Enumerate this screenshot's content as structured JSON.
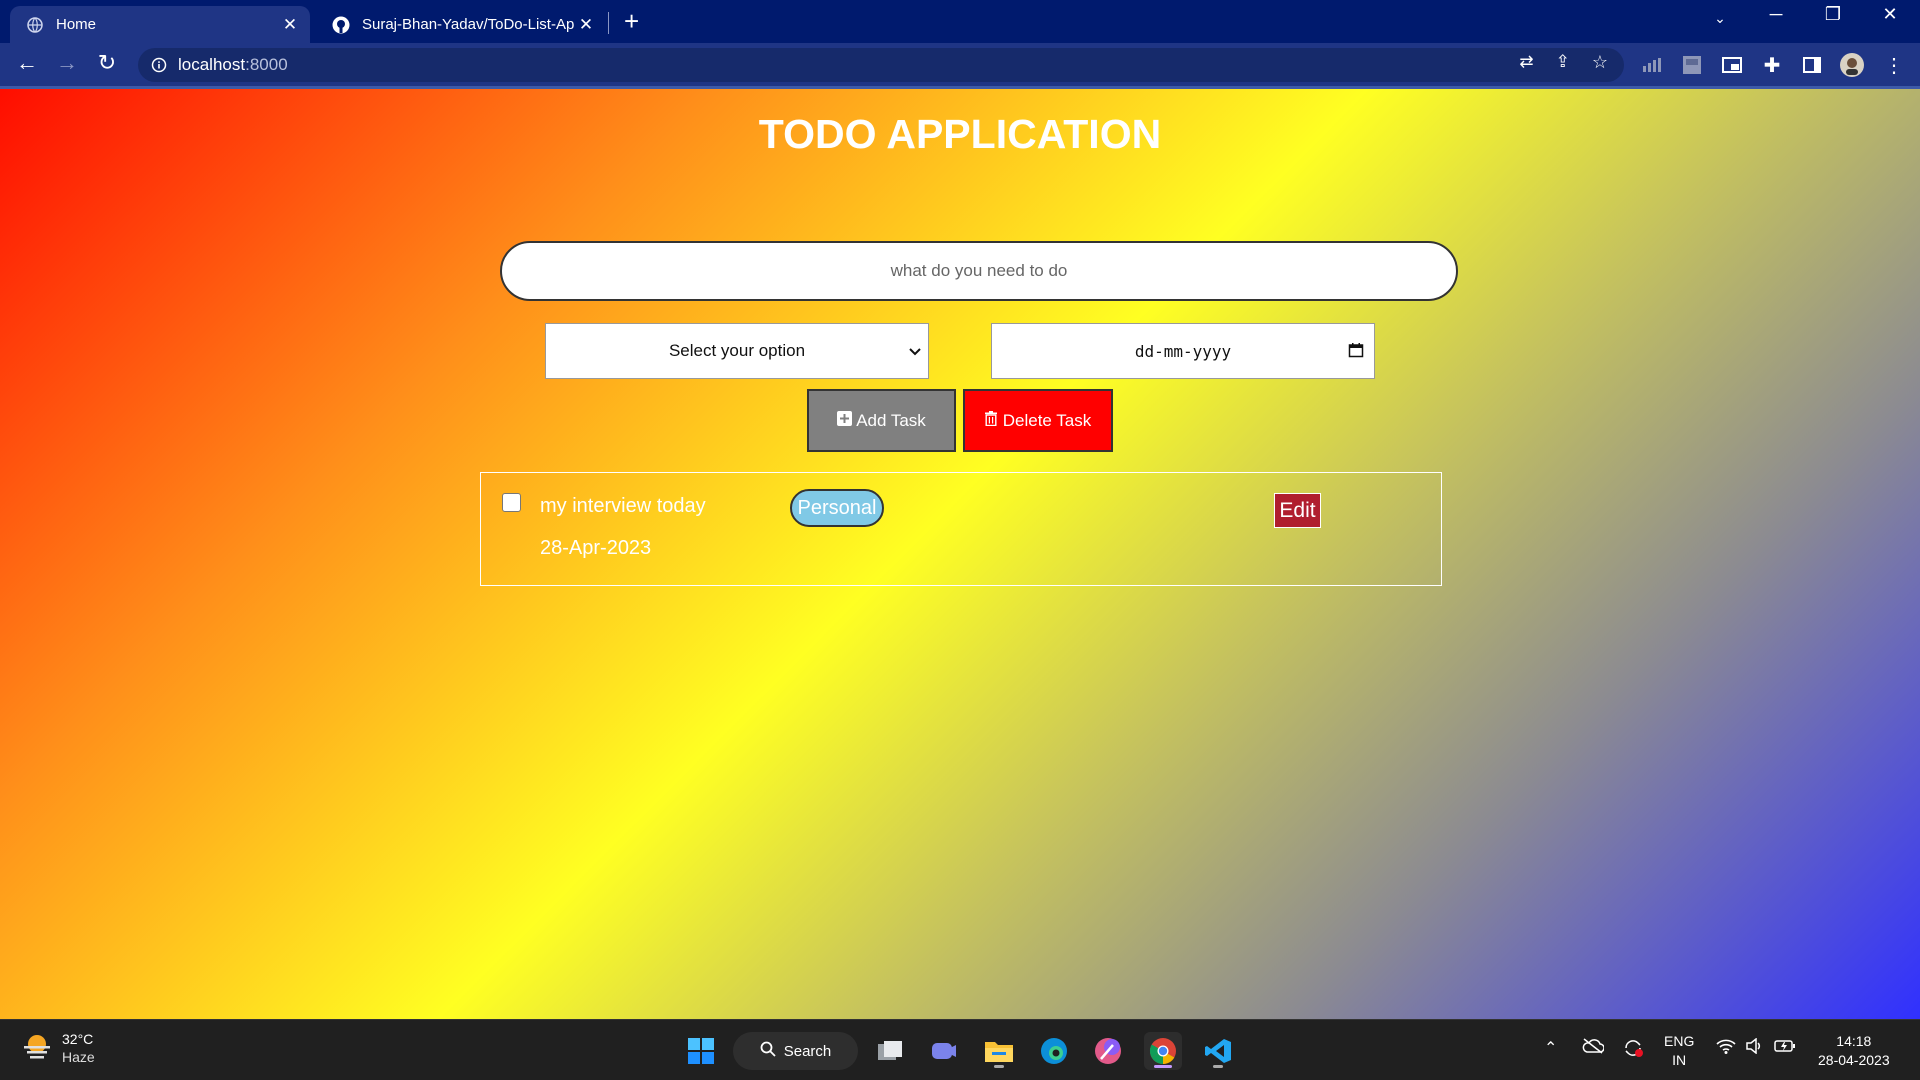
{
  "browser": {
    "tabs": [
      {
        "title": "Home",
        "active": true
      },
      {
        "title": "Suraj-Bhan-Yadav/ToDo-List-App",
        "active": false
      }
    ],
    "url_host": "localhost",
    "url_port": ":8000"
  },
  "app": {
    "title": "TODO APPLICATION",
    "input_placeholder": "what do you need to do",
    "category_select_value": "Select your option",
    "date_placeholder": "dd-mm-yyyy",
    "add_label": "Add Task",
    "delete_label": "Delete Task",
    "tasks": [
      {
        "text": "my interview today",
        "date": "28-Apr-2023",
        "category": "Personal",
        "edit_label": "Edit",
        "done": false
      }
    ]
  },
  "taskbar": {
    "weather_temp": "32°C",
    "weather_cond": "Haze",
    "search_label": "Search",
    "lang_1": "ENG",
    "lang_2": "IN",
    "time": "14:18",
    "date": "28-04-2023"
  },
  "colors": {
    "add_button": "#808080",
    "delete_button": "#ff0000",
    "tag_personal": "#80c9e6",
    "edit_button": "#b01e2e"
  }
}
